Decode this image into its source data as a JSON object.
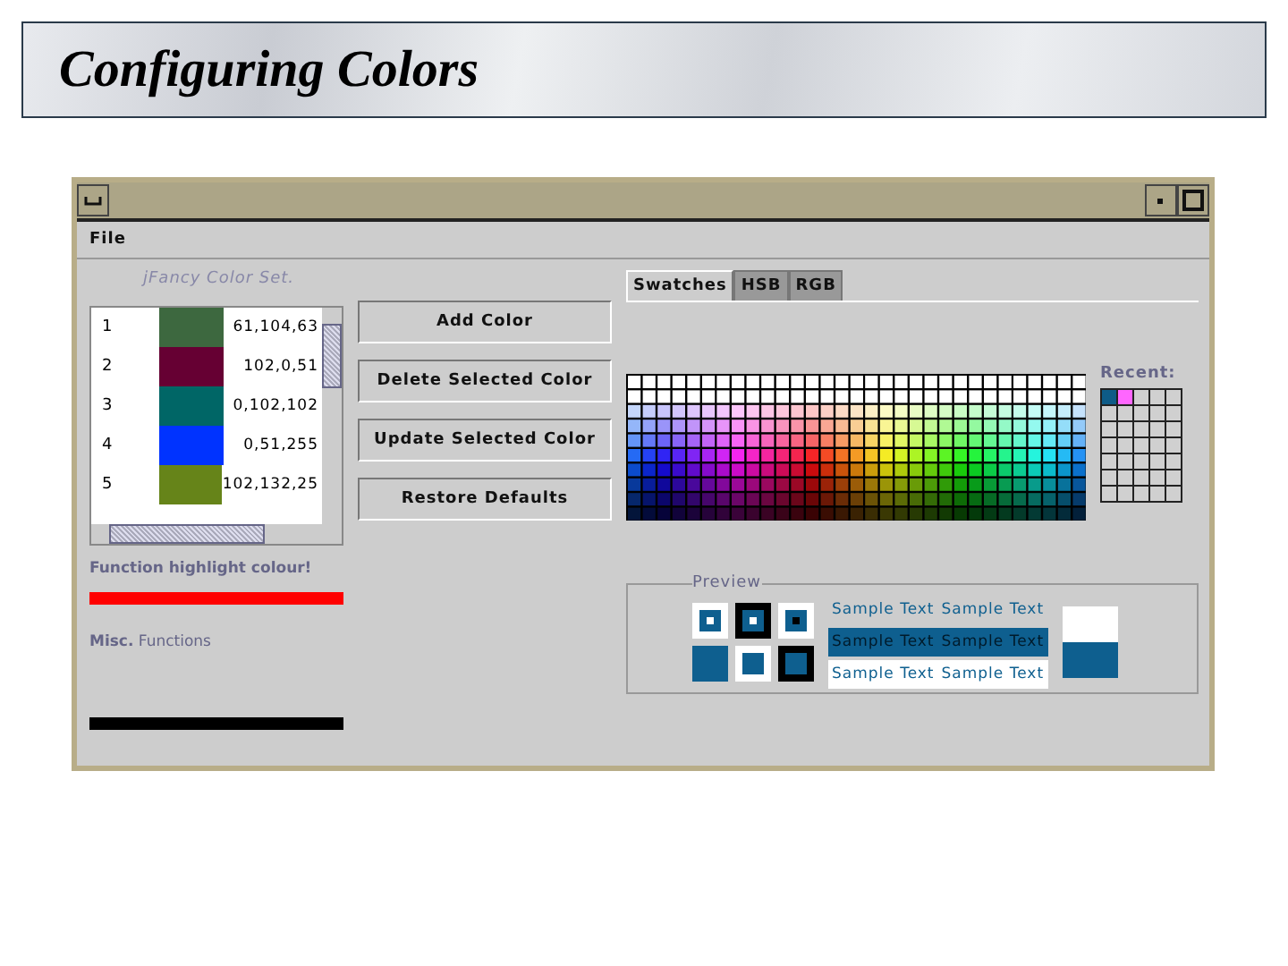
{
  "slide_title": "Configuring Colors",
  "window": {
    "menu": [
      "File"
    ],
    "set_title": "jFancy Color Set.",
    "colors": [
      {
        "index": "1",
        "color": "#3d683f",
        "value": "61,104,63"
      },
      {
        "index": "2",
        "color": "#660033",
        "value": "102,0,51"
      },
      {
        "index": "3",
        "color": "#006666",
        "value": "0,102,102"
      },
      {
        "index": "4",
        "color": "#0033ff",
        "value": "0,51,255"
      },
      {
        "index": "5",
        "color": "#668419",
        "value": "102,132,25"
      }
    ],
    "buttons": [
      "Add Color",
      "Delete Selected Color",
      "Update Selected Color",
      "Restore Defaults"
    ],
    "highlight": {
      "label": "Function highlight colour!",
      "color": "#ff0000"
    },
    "misc": {
      "label": "**Misc.** Functions",
      "color": "#000000"
    },
    "tabs": [
      {
        "label": "Swatches",
        "selected": true
      },
      {
        "label": "HSB",
        "selected": false
      },
      {
        "label": "RGB",
        "selected": false
      }
    ],
    "recent_label": "Recent:",
    "recent": [
      {
        "color": "#0e5b87"
      },
      {
        "color": "#ff66ff"
      }
    ],
    "preview": {
      "label": "Preview",
      "color": "#0e5f8f",
      "texts": [
        "Sample Text",
        "Sample Text",
        "Sample Text",
        "Sample Text",
        "Sample Text",
        "Sample Text"
      ]
    }
  }
}
